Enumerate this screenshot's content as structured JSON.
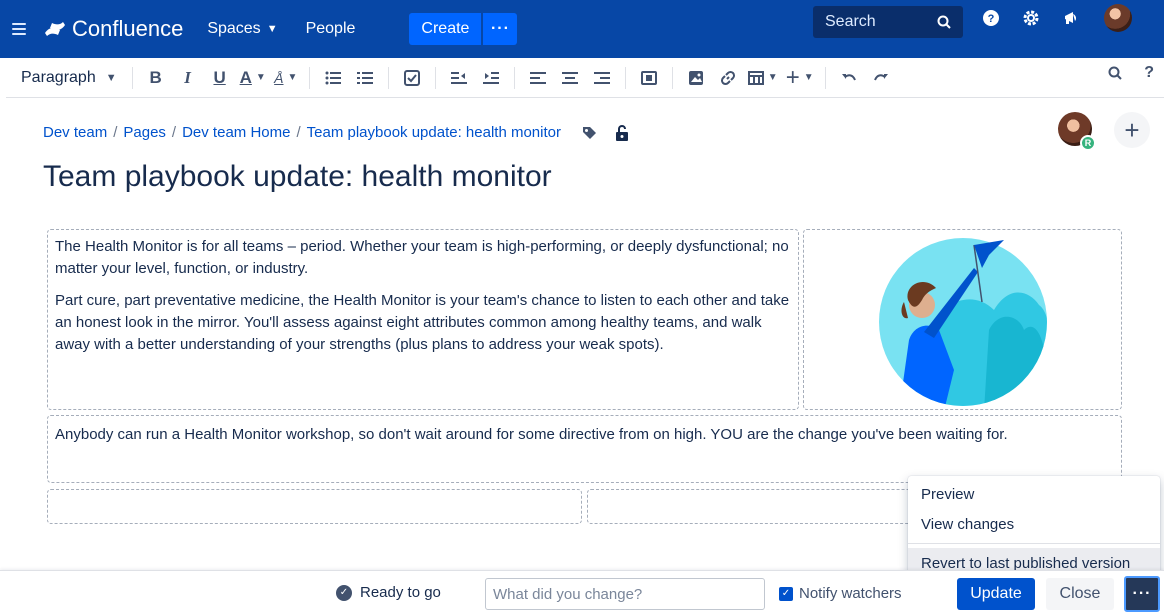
{
  "topnav": {
    "app_name": "Confluence",
    "spaces_label": "Spaces",
    "people_label": "People",
    "create_label": "Create",
    "more_label": "···",
    "search_placeholder": "Search"
  },
  "toolbar": {
    "paragraph_label": "Paragraph",
    "bold_label": "B",
    "italic_label": "I",
    "underline_label": "U",
    "text_color_label": "A"
  },
  "page": {
    "breadcrumb": [
      "Dev team",
      "Pages",
      "Dev team Home",
      "Team playbook update: health monitor"
    ],
    "title": "Team playbook update: health monitor",
    "collaborator_badge": "R",
    "paragraph1": "The Health Monitor is for all teams – period. Whether your team is high-performing, or deeply dysfunctional; no matter your level, function, or industry.",
    "paragraph2": "Part cure, part preventative medicine, the Health Monitor is your team's chance to listen to each other and take an honest look in the mirror. You'll assess against eight attributes common among healthy teams, and walk away with a better understanding of your strengths (plus plans to address your weak spots).",
    "paragraph3": "Anybody can run a Health Monitor workshop, so don't wait around for some directive from on high. YOU are the change you've been waiting for."
  },
  "menu": {
    "items": [
      "Preview",
      "View changes"
    ],
    "revert_label": "Revert to last published version"
  },
  "bottombar": {
    "status_label": "Ready to go",
    "change_placeholder": "What did you change?",
    "notify_label": "Notify watchers",
    "notify_checked": true,
    "update_label": "Update",
    "close_label": "Close",
    "more_label": "···"
  },
  "colors": {
    "nav_bg": "#0747A6",
    "primary": "#0052CC",
    "create_bg": "#0065FF"
  }
}
